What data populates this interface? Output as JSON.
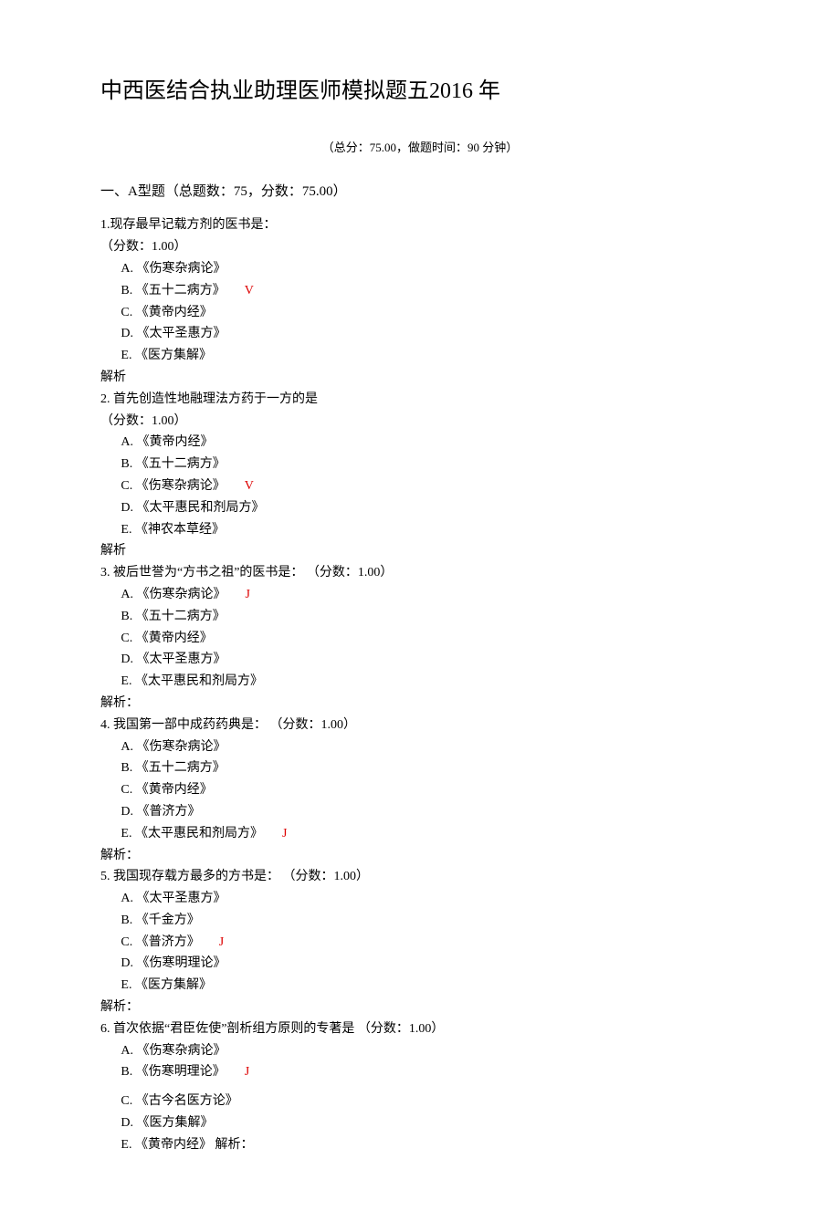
{
  "title": "中西医结合执业助理医师模拟题五2016 年",
  "meta": "（总分：75.00，做题时间：90 分钟）",
  "section_title": "一、A型题（总题数：75，分数：75.00）",
  "q1": {
    "stem": "1.现存最早记载方剂的医书是：",
    "score": "（分数：1.00）",
    "A": "A.  《伤寒杂病论》",
    "B": "B.  《五十二病方》",
    "B_mark": "V",
    "C": "C.  《黄帝内经》",
    "D": "D.  《太平圣惠方》",
    "E": "E.  《医方集解》",
    "analysis": "解析"
  },
  "q2": {
    "stem": "2. 首先创造性地融理法方药于一方的是",
    "score": "（分数：1.00）",
    "A": "A.  《黄帝内经》",
    "B": "B.  《五十二病方》",
    "C": "C.  《伤寒杂病论》",
    "C_mark": "V",
    "D": "D.  《太平惠民和剂局方》",
    "E": "E.  《神农本草经》",
    "analysis": "解析"
  },
  "q3": {
    "stem": "3.    被后世誉为“方书之祖”的医书是：  （分数：1.00）",
    "A": "A.  《伤寒杂病论》",
    "A_mark": "J",
    "B": "B.  《五十二病方》",
    "C": "C.  《黄帝内经》",
    "D": "D.  《太平圣惠方》",
    "E": "E.  《太平惠民和剂局方》",
    "analysis": "解析："
  },
  "q4": {
    "stem": "4.    我国第一部中成药药典是：  （分数：1.00）",
    "A": "A.  《伤寒杂病论》",
    "B": "B.  《五十二病方》",
    "C": "C.  《黄帝内经》",
    "D": "D.  《普济方》",
    "E": "E.  《太平惠民和剂局方》",
    "E_mark": "J",
    "analysis": "解析："
  },
  "q5": {
    "stem": "5.  我国现存载方最多的方书是：  （分数：1.00）",
    "A": "A.  《太平圣惠方》",
    "B": "B.  《千金方》",
    "C": "C.  《普济方》",
    "C_mark": "J",
    "D": "D.  《伤寒明理论》",
    "E": "E.  《医方集解》",
    "analysis": "解析："
  },
  "q6": {
    "stem": "6. 首次依据“君臣佐使”剖析组方原则的专著是  （分数：1.00）",
    "A": "A.  《伤寒杂病论》",
    "B": "B.  《伤寒明理论》",
    "B_mark": "J",
    "C": "C.  《古今名医方论》",
    "D": "D.  《医方集解》",
    "E": "E.  《黄帝内经》 解析："
  }
}
